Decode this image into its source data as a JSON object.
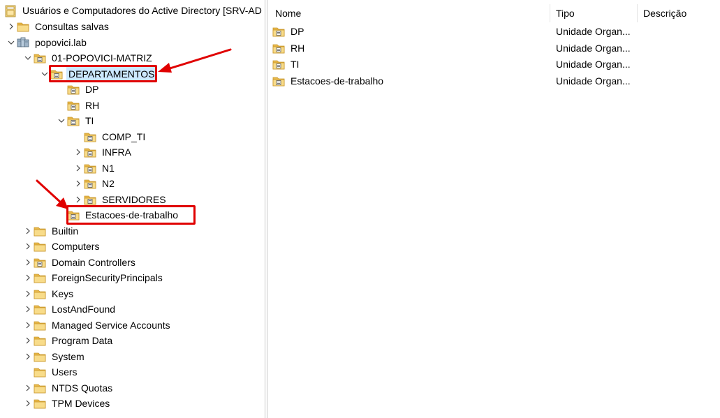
{
  "tree": {
    "root": {
      "label": "Usuários e Computadores do Active Directory [SRV-AD",
      "icon": "ad-console-icon"
    },
    "items": [
      {
        "id": "consultas",
        "label": "Consultas salvas",
        "icon": "folder-icon",
        "expander": "collapsed"
      },
      {
        "id": "domain",
        "label": "popovici.lab",
        "icon": "domain-icon",
        "expander": "expanded"
      },
      {
        "id": "matriz",
        "label": "01-POPOVICI-MATRIZ",
        "icon": "ou-icon",
        "expander": "expanded"
      },
      {
        "id": "departamentos",
        "label": "DEPARTAMENTOS",
        "icon": "ou-icon",
        "expander": "expanded",
        "selected": true
      },
      {
        "id": "dp",
        "label": "DP",
        "icon": "ou-icon",
        "expander": "none"
      },
      {
        "id": "rh",
        "label": "RH",
        "icon": "ou-icon",
        "expander": "none"
      },
      {
        "id": "ti",
        "label": "TI",
        "icon": "ou-icon",
        "expander": "expanded"
      },
      {
        "id": "comp_ti",
        "label": "COMP_TI",
        "icon": "ou-icon",
        "expander": "none"
      },
      {
        "id": "infra",
        "label": "INFRA",
        "icon": "ou-icon",
        "expander": "collapsed"
      },
      {
        "id": "n1",
        "label": "N1",
        "icon": "ou-icon",
        "expander": "collapsed"
      },
      {
        "id": "n2",
        "label": "N2",
        "icon": "ou-icon",
        "expander": "collapsed"
      },
      {
        "id": "servidores",
        "label": "SERVIDORES",
        "icon": "ou-icon",
        "expander": "collapsed"
      },
      {
        "id": "estacoes",
        "label": "Estacoes-de-trabalho",
        "icon": "ou-icon",
        "expander": "none"
      },
      {
        "id": "builtin",
        "label": "Builtin",
        "icon": "folder-icon",
        "expander": "collapsed"
      },
      {
        "id": "computers",
        "label": "Computers",
        "icon": "folder-icon",
        "expander": "collapsed"
      },
      {
        "id": "dcs",
        "label": "Domain Controllers",
        "icon": "ou-icon",
        "expander": "collapsed"
      },
      {
        "id": "fsp",
        "label": "ForeignSecurityPrincipals",
        "icon": "folder-icon",
        "expander": "collapsed"
      },
      {
        "id": "keys",
        "label": "Keys",
        "icon": "folder-icon",
        "expander": "collapsed"
      },
      {
        "id": "lostfound",
        "label": "LostAndFound",
        "icon": "folder-icon",
        "expander": "collapsed"
      },
      {
        "id": "msa",
        "label": "Managed Service Accounts",
        "icon": "folder-icon",
        "expander": "collapsed"
      },
      {
        "id": "programdata",
        "label": "Program Data",
        "icon": "folder-icon",
        "expander": "collapsed"
      },
      {
        "id": "system",
        "label": "System",
        "icon": "folder-icon",
        "expander": "collapsed"
      },
      {
        "id": "users",
        "label": "Users",
        "icon": "folder-icon",
        "expander": "none"
      },
      {
        "id": "ntds",
        "label": "NTDS Quotas",
        "icon": "folder-icon",
        "expander": "collapsed"
      },
      {
        "id": "tpm",
        "label": "TPM Devices",
        "icon": "folder-icon",
        "expander": "collapsed"
      }
    ]
  },
  "list": {
    "columns": {
      "name": "Nome",
      "type": "Tipo",
      "description": "Descrição"
    },
    "rows": [
      {
        "name": "DP",
        "type": "Unidade Organ...",
        "icon": "ou-icon"
      },
      {
        "name": "RH",
        "type": "Unidade Organ...",
        "icon": "ou-icon"
      },
      {
        "name": "TI",
        "type": "Unidade Organ...",
        "icon": "ou-icon"
      },
      {
        "name": "Estacoes-de-trabalho",
        "type": "Unidade Organ...",
        "icon": "ou-icon"
      }
    ]
  },
  "annotations": {
    "highlight_color": "#e00000",
    "highlighted_items": [
      "DEPARTAMENTOS",
      "Estacoes-de-trabalho"
    ]
  },
  "colors": {
    "selection": "#cce8ff",
    "folder": "#e8b84a",
    "folder_light": "#f8dc8a"
  }
}
